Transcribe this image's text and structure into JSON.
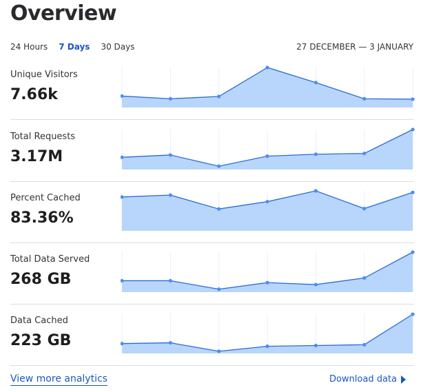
{
  "header": {
    "title": "Overview"
  },
  "range_tabs": [
    {
      "label": "24 Hours",
      "active": false
    },
    {
      "label": "7 Days",
      "active": true
    },
    {
      "label": "30 Days",
      "active": false
    }
  ],
  "date_range": "27 DECEMBER — 3 JANUARY",
  "colors": {
    "accent": "#1a56c4",
    "line": "#2a6ad8",
    "fill": "#b8d5fb",
    "point": "#4a8ef5",
    "grid": "#e8effb"
  },
  "chart_data": [
    {
      "type": "area",
      "title": "Unique Visitors",
      "summary": "7.66k",
      "x": [
        1,
        2,
        3,
        4,
        5,
        6,
        7
      ],
      "values_normalized": [
        0.26,
        0.19,
        0.25,
        1.0,
        0.61,
        0.19,
        0.18
      ]
    },
    {
      "type": "area",
      "title": "Total Requests",
      "summary": "3.17M",
      "x": [
        1,
        2,
        3,
        4,
        5,
        6,
        7
      ],
      "values_normalized": [
        0.28,
        0.34,
        0.05,
        0.31,
        0.36,
        0.38,
        1.0
      ]
    },
    {
      "type": "area",
      "title": "Percent Cached",
      "summary": "83.36%",
      "x": [
        1,
        2,
        3,
        4,
        5,
        6,
        7
      ],
      "values_normalized": [
        0.84,
        0.89,
        0.53,
        0.72,
        1.0,
        0.54,
        0.96
      ]
    },
    {
      "type": "area",
      "title": "Total Data Served",
      "summary": "268 GB",
      "x": [
        1,
        2,
        3,
        4,
        5,
        6,
        7
      ],
      "values_normalized": [
        0.26,
        0.26,
        0.04,
        0.21,
        0.16,
        0.33,
        1.0
      ]
    },
    {
      "type": "area",
      "title": "Data Cached",
      "summary": "223 GB",
      "x": [
        1,
        2,
        3,
        4,
        5,
        6,
        7
      ],
      "values_normalized": [
        0.22,
        0.24,
        0.02,
        0.15,
        0.17,
        0.19,
        0.98
      ]
    }
  ],
  "footer": {
    "more_link": "View more analytics",
    "download_label": "Download data"
  }
}
